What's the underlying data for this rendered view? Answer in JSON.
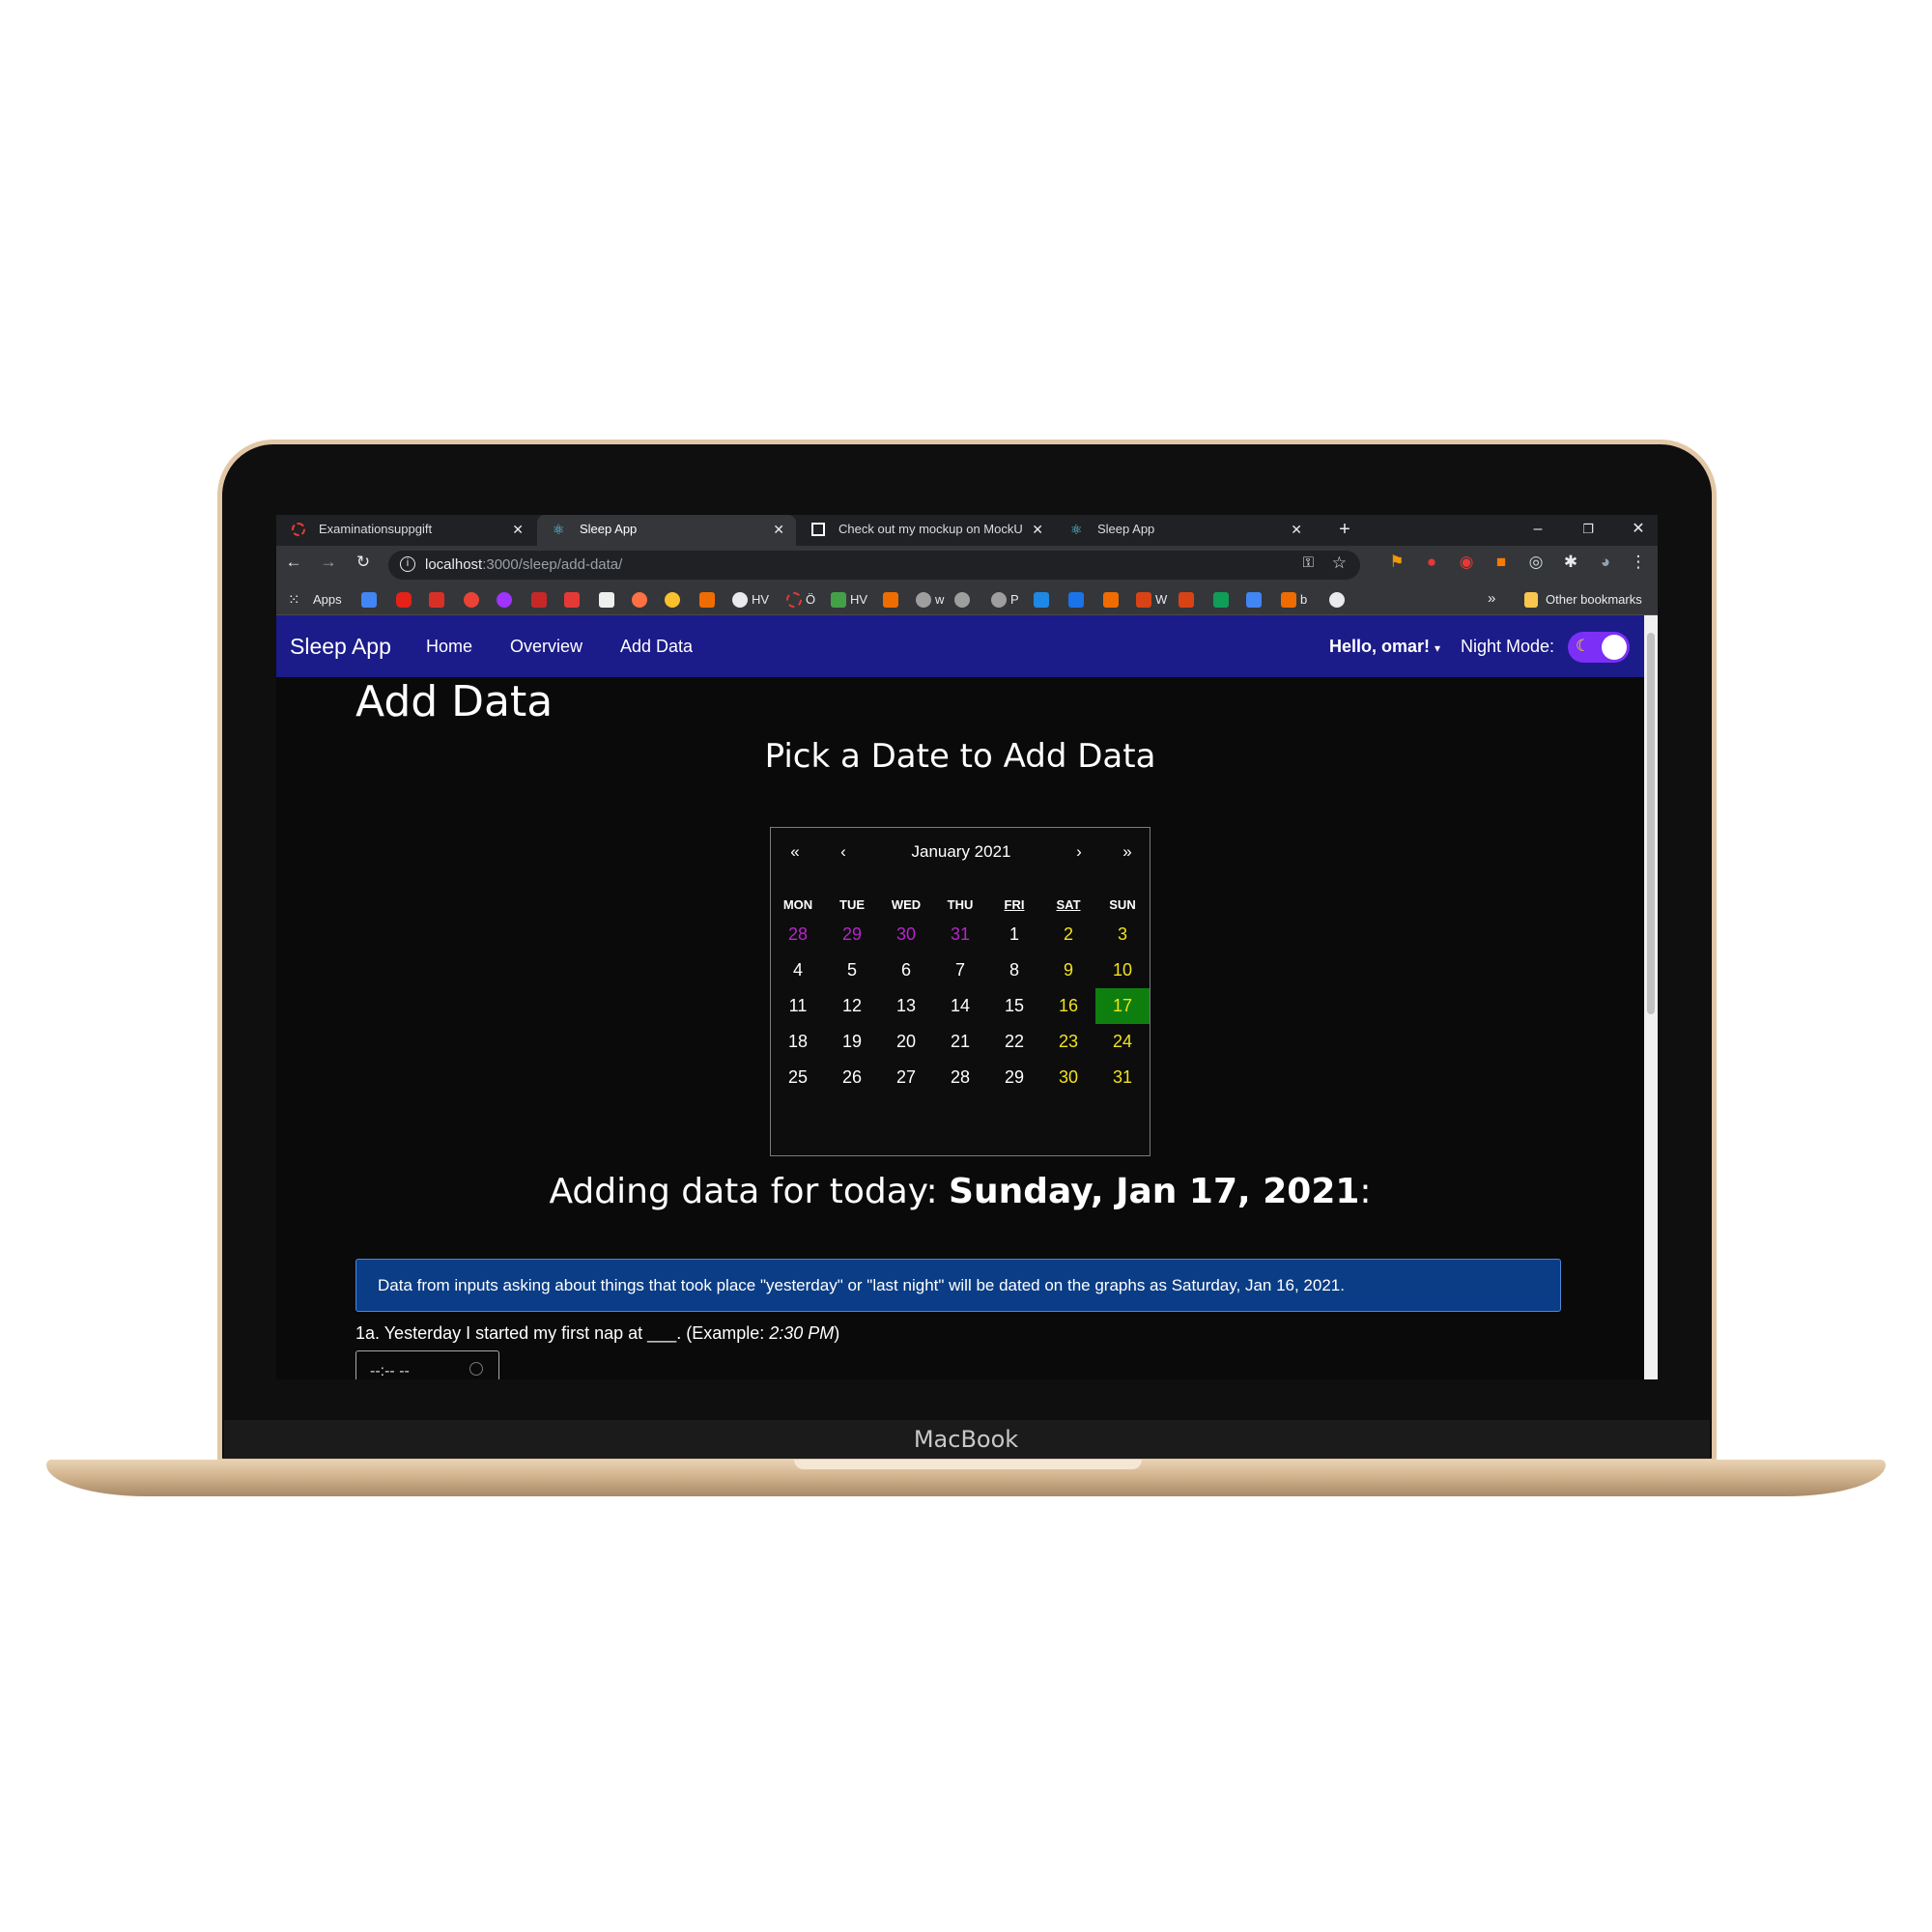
{
  "device": {
    "label": "MacBook"
  },
  "browser": {
    "tabs": [
      {
        "title": "Examinationsuppgift",
        "active": false
      },
      {
        "title": "Sleep App",
        "active": true
      },
      {
        "title": "Check out my mockup on MockU",
        "active": false
      },
      {
        "title": "Sleep App",
        "active": false
      }
    ],
    "new_tab": "+",
    "window_controls": {
      "minimize": "–",
      "restore": "❐",
      "close": "✕"
    },
    "url": {
      "host": "localhost",
      "path": ":3000/sleep/add-data/"
    },
    "bookmarks": {
      "apps": "Apps",
      "items": [
        "HV",
        "Ö",
        "HV",
        "w",
        "P",
        "W",
        "b"
      ],
      "overflow": "»",
      "other": "Other bookmarks"
    }
  },
  "navbar": {
    "brand": "Sleep App",
    "links": [
      "Home",
      "Overview",
      "Add Data"
    ],
    "user": "Hello, omar!",
    "night_mode_label": "Night Mode:",
    "night_mode_on": true
  },
  "page": {
    "title": "Add Data",
    "subtitle": "Pick a Date to Add Data",
    "adding_prefix": "Adding data for today: ",
    "adding_date": "Sunday, Jan 17, 2021",
    "adding_suffix": ":",
    "note": "Data from inputs asking about things that took place \"yesterday\" or \"last night\" will be dated on the graphs as Saturday, Jan 16, 2021.",
    "question_1a": {
      "text": "1a. Yesterday I started my first nap at ___. (Example: ",
      "example": "2:30 PM",
      "suffix": ")",
      "input_placeholder": "--:-- --"
    }
  },
  "calendar": {
    "nav": {
      "prev_year": "«",
      "prev_month": "‹",
      "label": "January 2021",
      "next_month": "›",
      "next_year": "»"
    },
    "weekdays": [
      "MON",
      "TUE",
      "WED",
      "THU",
      "FRI",
      "SAT",
      "SUN"
    ],
    "weeks": [
      [
        "28",
        "29",
        "30",
        "31",
        "1",
        "2",
        "3"
      ],
      [
        "4",
        "5",
        "6",
        "7",
        "8",
        "9",
        "10"
      ],
      [
        "11",
        "12",
        "13",
        "14",
        "15",
        "16",
        "17"
      ],
      [
        "18",
        "19",
        "20",
        "21",
        "22",
        "23",
        "24"
      ],
      [
        "25",
        "26",
        "27",
        "28",
        "29",
        "30",
        "31"
      ]
    ],
    "prev_month_days": [
      "28",
      "29",
      "30",
      "31"
    ],
    "selected": "17",
    "colors": {
      "prev_month": "#b526c9",
      "weekend": "#f2e21b",
      "selected_bg": "#0e7f0e"
    }
  },
  "colors": {
    "navbar": "#1b1b8a",
    "note_bg": "#0a3d86",
    "toggle": "#7b2ff7"
  }
}
